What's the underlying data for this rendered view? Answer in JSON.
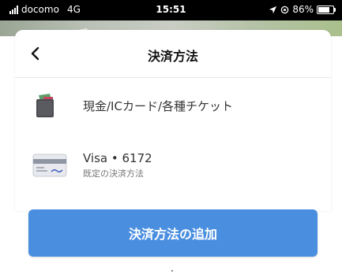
{
  "status_bar": {
    "carrier": "docomo",
    "network": "4G",
    "time": "15:51",
    "battery": "86%",
    "battery_level": 0.86
  },
  "header": {
    "title": "決済方法"
  },
  "payment_methods": [
    {
      "label": "現金/ICカード/各種チケット",
      "icon": "wallet-icon"
    },
    {
      "label": "Visa • 6172",
      "sublabel": "既定の決済方法",
      "icon": "credit-card-icon"
    }
  ],
  "actions": {
    "add_label": "決済方法の追加"
  },
  "colors": {
    "accent": "#4a8ee0",
    "status_bar_bg": "#000000",
    "title_text": "#111111",
    "body_text": "#333333",
    "sub_text": "#777777"
  }
}
